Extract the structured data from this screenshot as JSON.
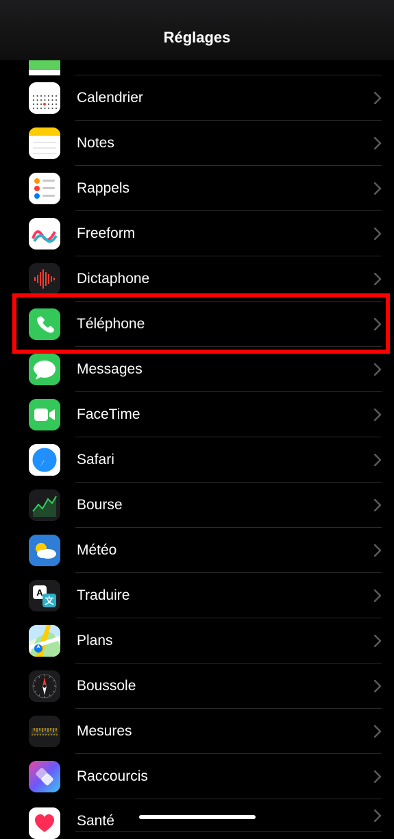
{
  "header": {
    "title": "Réglages"
  },
  "highlight_key": "telephone",
  "items": [
    {
      "key": "partial-top",
      "label": "",
      "icon": "partial-top",
      "bg": "#ffffff"
    },
    {
      "key": "calendrier",
      "label": "Calendrier",
      "icon": "calendar",
      "bg": "#ffffff"
    },
    {
      "key": "notes",
      "label": "Notes",
      "icon": "notes",
      "bg": "#ffffff"
    },
    {
      "key": "rappels",
      "label": "Rappels",
      "icon": "reminders",
      "bg": "#ffffff"
    },
    {
      "key": "freeform",
      "label": "Freeform",
      "icon": "freeform",
      "bg": "#ffffff"
    },
    {
      "key": "dictaphone",
      "label": "Dictaphone",
      "icon": "voice-memos",
      "bg": "#1c1c1e"
    },
    {
      "key": "telephone",
      "label": "Téléphone",
      "icon": "phone",
      "bg": "#34c759"
    },
    {
      "key": "messages",
      "label": "Messages",
      "icon": "messages",
      "bg": "#34c759"
    },
    {
      "key": "facetime",
      "label": "FaceTime",
      "icon": "facetime",
      "bg": "#34c759"
    },
    {
      "key": "safari",
      "label": "Safari",
      "icon": "safari",
      "bg": "#ffffff"
    },
    {
      "key": "bourse",
      "label": "Bourse",
      "icon": "stocks",
      "bg": "#1c1c1e"
    },
    {
      "key": "meteo",
      "label": "Météo",
      "icon": "weather",
      "bg": "#2e7dd7"
    },
    {
      "key": "traduire",
      "label": "Traduire",
      "icon": "translate",
      "bg": "#1c1c1e"
    },
    {
      "key": "plans",
      "label": "Plans",
      "icon": "maps",
      "bg": "#ffffff"
    },
    {
      "key": "boussole",
      "label": "Boussole",
      "icon": "compass",
      "bg": "#1c1c1e"
    },
    {
      "key": "mesures",
      "label": "Mesures",
      "icon": "measure",
      "bg": "#1c1c1e"
    },
    {
      "key": "raccourcis",
      "label": "Raccourcis",
      "icon": "shortcuts",
      "bg": "#3d4b9e"
    },
    {
      "key": "sante",
      "label": "Santé",
      "icon": "health",
      "bg": "#ffffff"
    }
  ]
}
